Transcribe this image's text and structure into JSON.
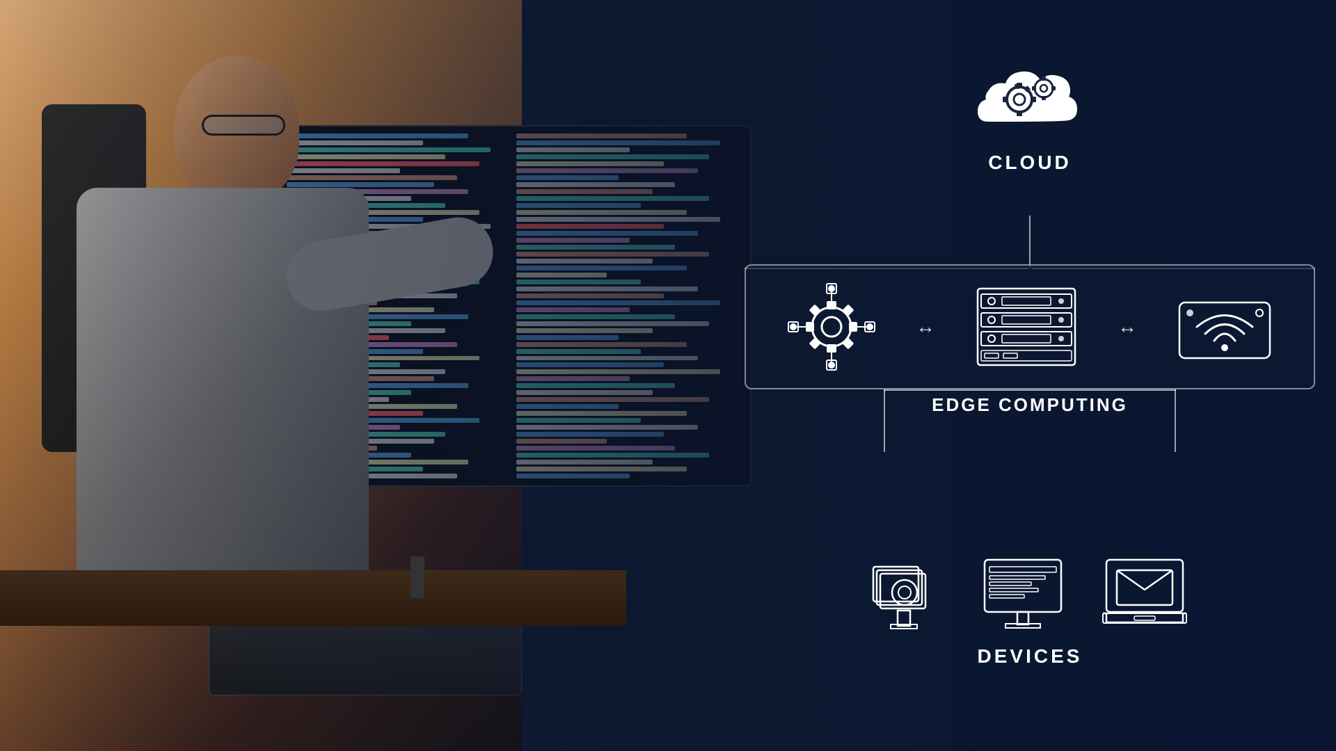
{
  "diagram": {
    "cloud": {
      "label": "CLOUD"
    },
    "edge": {
      "label": "EDGE COMPUTING"
    },
    "devices": {
      "label": "DEVICES"
    }
  },
  "arrows": {
    "left_right": "↔",
    "left_right2": "↔"
  }
}
